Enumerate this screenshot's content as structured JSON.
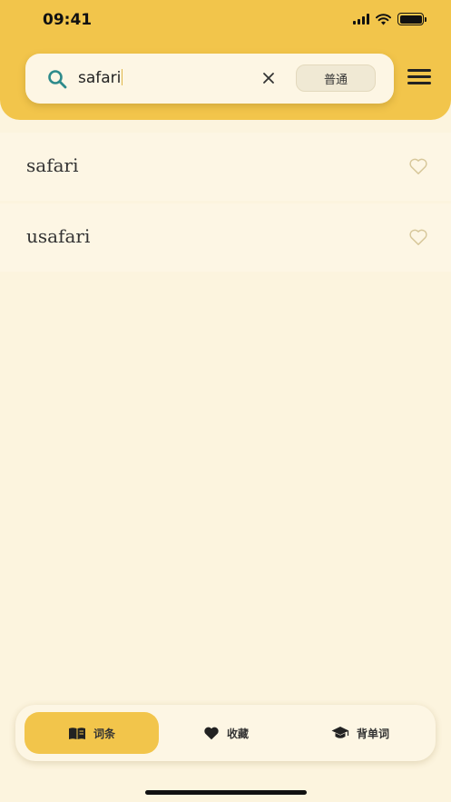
{
  "status_bar": {
    "time": "09:41"
  },
  "search": {
    "query": "safari",
    "mode_label": "普通"
  },
  "results": [
    {
      "word": "safari"
    },
    {
      "word": "usafari"
    }
  ],
  "tabs": [
    {
      "label": "词条",
      "icon": "book-icon",
      "active": true
    },
    {
      "label": "收藏",
      "icon": "heart-icon",
      "active": false
    },
    {
      "label": "背单词",
      "icon": "graduation-cap-icon",
      "active": false
    }
  ],
  "colors": {
    "accent": "#f2c54b",
    "background": "#fcf4de",
    "item_bg": "#fdf6e4",
    "search_icon": "#2e8b8b"
  }
}
